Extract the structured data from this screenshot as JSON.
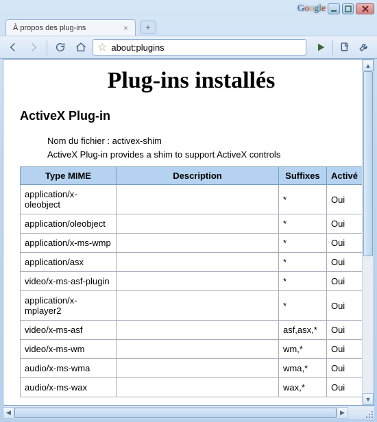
{
  "window": {
    "google_label": "Google",
    "tab_title": "À propos des plug-ins"
  },
  "toolbar": {
    "url": "about:plugins"
  },
  "page": {
    "title": "Plug-ins installés",
    "plugin_name": "ActiveX Plug-in",
    "filename_line": "Nom du fichier : activex-shim",
    "desc_line": "ActiveX Plug-in provides a shim to support ActiveX controls",
    "headers": {
      "mime": "Type MIME",
      "desc": "Description",
      "suffix": "Suffixes",
      "enabled": "Activé"
    },
    "rows": [
      {
        "mime": "application/x-oleobject",
        "desc": "",
        "suffix": "*",
        "enabled": "Oui"
      },
      {
        "mime": "application/oleobject",
        "desc": "",
        "suffix": "*",
        "enabled": "Oui"
      },
      {
        "mime": "application/x-ms-wmp",
        "desc": "",
        "suffix": "*",
        "enabled": "Oui"
      },
      {
        "mime": "application/asx",
        "desc": "",
        "suffix": "*",
        "enabled": "Oui"
      },
      {
        "mime": "video/x-ms-asf-plugin",
        "desc": "",
        "suffix": "*",
        "enabled": "Oui"
      },
      {
        "mime": "application/x-mplayer2",
        "desc": "",
        "suffix": "*",
        "enabled": "Oui"
      },
      {
        "mime": "video/x-ms-asf",
        "desc": "",
        "suffix": "asf,asx,*",
        "enabled": "Oui"
      },
      {
        "mime": "video/x-ms-wm",
        "desc": "",
        "suffix": "wm,*",
        "enabled": "Oui"
      },
      {
        "mime": "audio/x-ms-wma",
        "desc": "",
        "suffix": "wma,*",
        "enabled": "Oui"
      },
      {
        "mime": "audio/x-ms-wax",
        "desc": "",
        "suffix": "wax,*",
        "enabled": "Oui"
      }
    ]
  }
}
